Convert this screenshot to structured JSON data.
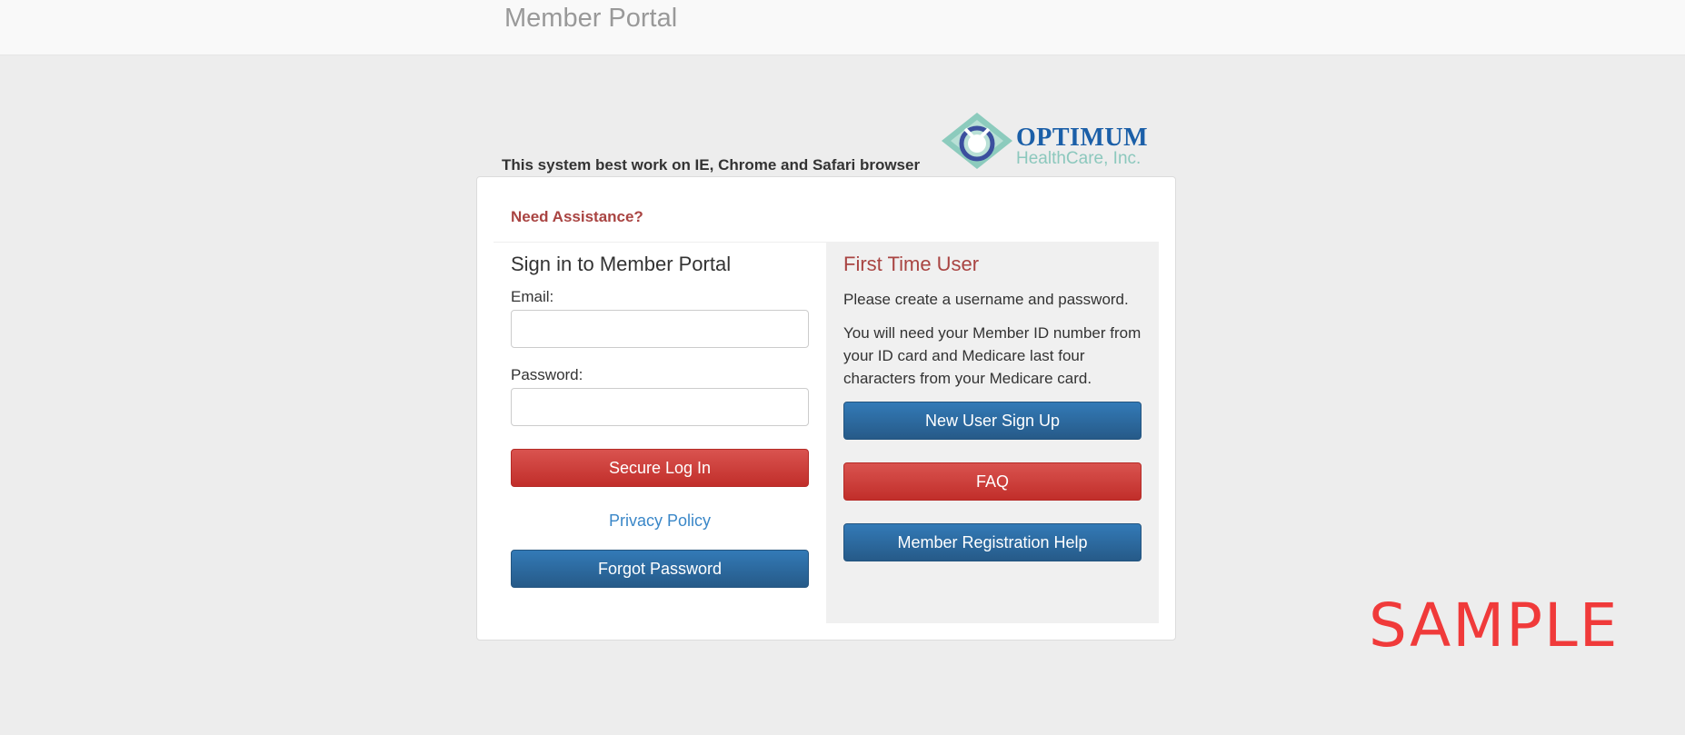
{
  "header": {
    "brand": "Member Portal"
  },
  "notice": {
    "browser": "This system best work on IE, Chrome and Safari browser"
  },
  "logo": {
    "line1": "OPTIMUM",
    "line2": "HealthCare, Inc."
  },
  "panel": {
    "assistance": "Need Assistance?",
    "signin": {
      "title": "Sign in to Member Portal",
      "email_label": "Email:",
      "email_value": "",
      "password_label": "Password:",
      "password_value": "",
      "login_button": "Secure Log In",
      "privacy_link": "Privacy Policy",
      "forgot_button": "Forgot Password"
    },
    "first_time": {
      "title": "First Time User",
      "text1": "Please create a username and password.",
      "text2": "You will need your Member ID number from your ID card and Medicare last four characters from your Medicare card.",
      "signup_button": "New User Sign Up",
      "faq_button": "FAQ",
      "help_button": "Member Registration Help"
    }
  },
  "watermark": "SAMPLE",
  "colors": {
    "red": "#d9534f",
    "blue": "#337ab7",
    "heading_red": "#a94442",
    "link": "#3a87c8",
    "logo_blue": "#1b5fa8",
    "logo_teal": "#8cc8bd"
  }
}
